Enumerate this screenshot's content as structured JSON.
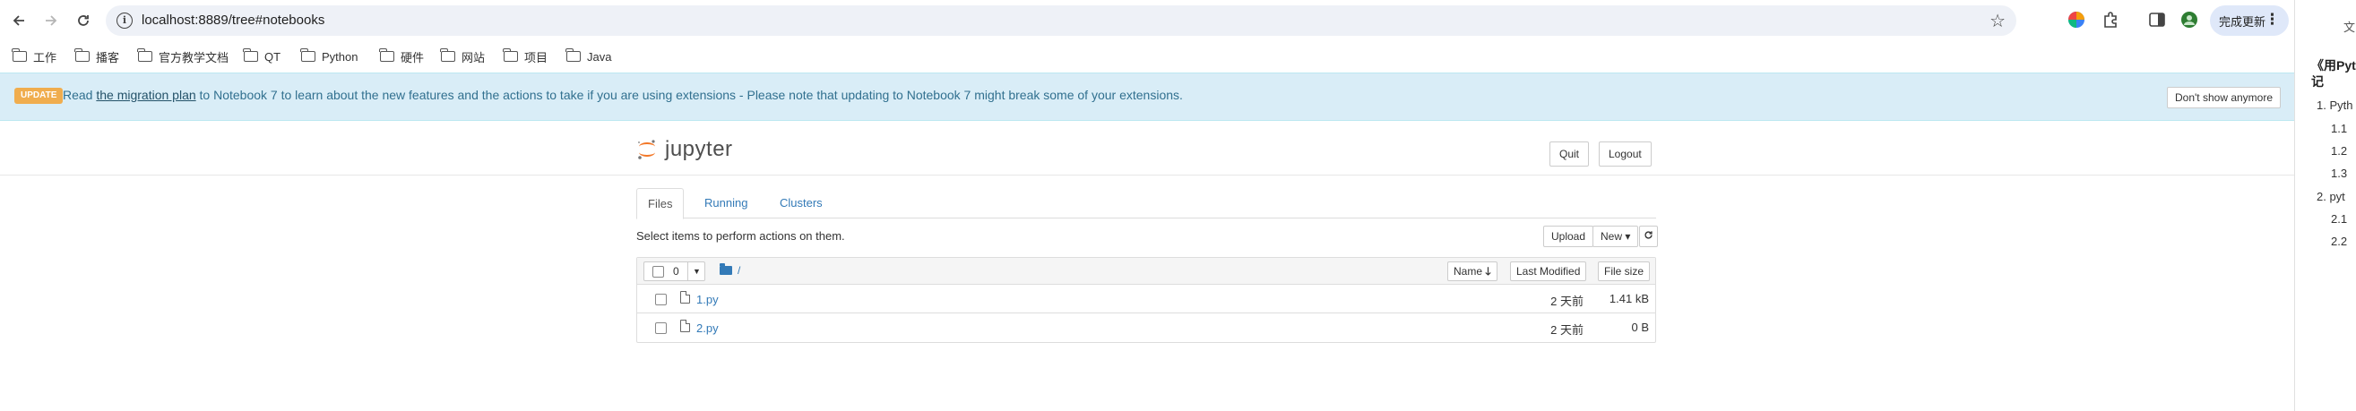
{
  "browser": {
    "url": "localhost:8889/tree#notebooks",
    "update_button": "完成更新",
    "bookmarks": [
      "工作",
      "播客",
      "官方教学文档",
      "QT",
      "Python",
      "硬件",
      "网站",
      "项目",
      "Java"
    ]
  },
  "banner": {
    "badge": "UPDATE",
    "text_pre": "Read",
    "link": "the migration plan",
    "text_post": "to Notebook 7 to learn about the new features and the actions to take if you are using extensions - Please note that updating to Notebook 7 might break some of your extensions.",
    "dismiss": "Don't show anymore"
  },
  "header": {
    "logo_text": "jupyter",
    "quit": "Quit",
    "logout": "Logout"
  },
  "tabs": [
    "Files",
    "Running",
    "Clusters"
  ],
  "toolbar": {
    "hint": "Select items to perform actions on them.",
    "upload": "Upload",
    "new": "New ▾"
  },
  "file_list": {
    "selected_count": "0",
    "breadcrumb": "/",
    "columns": {
      "name": "Name",
      "last_modified": "Last Modified",
      "file_size": "File size"
    },
    "files": [
      {
        "name": "1.py",
        "modified": "2 天前",
        "size": "1.41 kB"
      },
      {
        "name": "2.py",
        "modified": "2 天前",
        "size": "0 B"
      }
    ]
  },
  "side_panel": {
    "top": "文",
    "title_line1": "《用Pyt",
    "title_line2": "记",
    "items": [
      "1. Pyth",
      "1.1",
      "1.2",
      "1.3",
      "2. pyt",
      "2.1",
      "2.2"
    ]
  },
  "colors": {
    "link": "#337ab7",
    "banner_bg": "#d9edf7",
    "badge": "#f0ad4e",
    "jupyter_orange": "#f37726"
  }
}
